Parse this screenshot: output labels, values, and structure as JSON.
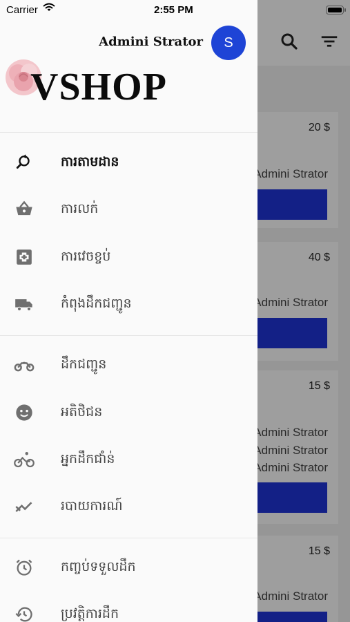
{
  "status_bar": {
    "carrier": "Carrier",
    "time": "2:55 PM"
  },
  "drawer": {
    "user_name": "Admini Strator",
    "avatar_initial": "S",
    "logo_text": "VSHOP",
    "menu_groups": [
      [
        {
          "label": "ការតាមដាន",
          "icon": "search-refresh-icon",
          "active": true
        },
        {
          "label": "ការលក់",
          "icon": "basket-icon"
        },
        {
          "label": "ការវេចខ្ចប់",
          "icon": "package-icon"
        },
        {
          "label": "កំពុងដឹកជញ្ជូន",
          "icon": "truck-icon"
        }
      ],
      [
        {
          "label": "ដឹកជញ្ជូន",
          "icon": "motorcycle-icon"
        },
        {
          "label": "អតិថិជន",
          "icon": "customer-face-icon"
        },
        {
          "label": "អ្នកដឹកជាំន់",
          "icon": "bicycle-icon"
        },
        {
          "label": "របាយការណ៍",
          "icon": "trending-chart-icon"
        }
      ],
      [
        {
          "label": "កញ្ចប់ទទួលដឹក",
          "icon": "alarm-clock-icon"
        },
        {
          "label": "ប្រវត្តិការដឹក",
          "icon": "history-icon"
        }
      ]
    ]
  },
  "background": {
    "cards": [
      {
        "price": "20 $",
        "lines": [
          "Admini Strator"
        ]
      },
      {
        "price": "40 $",
        "lines": [
          "Admini Strator"
        ]
      },
      {
        "price": "15 $",
        "lines": [
          "Admini Strator",
          "Admini Strator",
          "Admini Strator"
        ]
      },
      {
        "price": "15 $",
        "lines": [
          "Admini Strator"
        ]
      }
    ]
  },
  "colors": {
    "accent": "#1e44d6",
    "bar": "#1f35d8",
    "drawer_bg": "#fafafa"
  }
}
